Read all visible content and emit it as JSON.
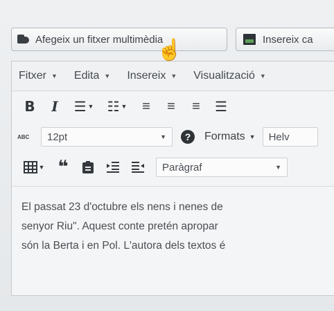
{
  "top_buttons": {
    "add_media": "Afegeix un fitxer multimèdia",
    "insert": "Insereix ca"
  },
  "menubar": [
    "Fitxer",
    "Edita",
    "Insereix",
    "Visualització"
  ],
  "toolbar1": {
    "bold": "B",
    "italic": "I",
    "bullet_list": "☰",
    "numbered_list": "☷",
    "align_left": "≡",
    "align_center": "≡",
    "align_right": "≡",
    "align_justify": "☰"
  },
  "toolbar2": {
    "font_size": "12pt",
    "help": "?",
    "formats": "Formats",
    "font_family": "Helv"
  },
  "toolbar3": {
    "blockquote": "❝",
    "block_format": "Paràgraf"
  },
  "content": {
    "lines": [
      "El passat 23 d'octubre els nens i nenes de",
      "senyor Riu\". Aquest conte pretén apropar",
      "són la Berta i en Pol. L'autora dels textos é"
    ]
  },
  "colors": {
    "accent_green": "#5fa05a",
    "text": "#4a4e53"
  },
  "icons": [
    "media-icon",
    "insert-icon",
    "table-icon",
    "paste-icon",
    "indent-icon",
    "outdent-icon",
    "strikethrough-abc-icon",
    "hand-cursor-icon"
  ]
}
